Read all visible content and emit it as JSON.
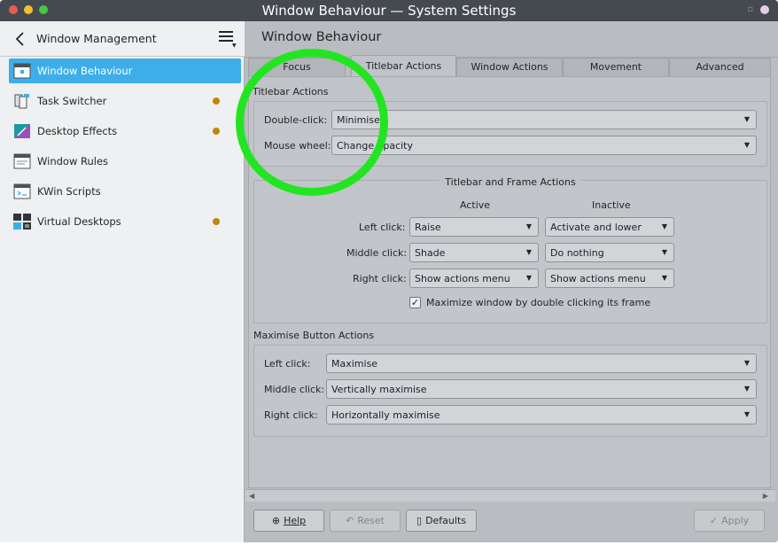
{
  "window": {
    "title": "Window Behaviour — System Settings"
  },
  "sidebar": {
    "title": "Window Management",
    "items": [
      {
        "label": "Window Behaviour",
        "selected": true,
        "dot": false
      },
      {
        "label": "Task Switcher",
        "selected": false,
        "dot": true
      },
      {
        "label": "Desktop Effects",
        "selected": false,
        "dot": true
      },
      {
        "label": "Window Rules",
        "selected": false,
        "dot": false
      },
      {
        "label": "KWin Scripts",
        "selected": false,
        "dot": false
      },
      {
        "label": "Virtual Desktops",
        "selected": false,
        "dot": true
      }
    ],
    "dot_color": "#c0860f",
    "selected_color": "#3daee9"
  },
  "main": {
    "title": "Window Behaviour",
    "tabs": [
      {
        "label": "Focus",
        "active": false
      },
      {
        "label": "Titlebar Actions",
        "active": true
      },
      {
        "label": "Window Actions",
        "active": false
      },
      {
        "label": "Movement",
        "active": false
      },
      {
        "label": "Advanced",
        "active": false
      }
    ]
  },
  "titlebar_actions": {
    "group_title": "Titlebar Actions",
    "double_click": {
      "label": "Double-click:",
      "value": "Minimise"
    },
    "mouse_wheel": {
      "label": "Mouse wheel:",
      "value": "Change opacity"
    }
  },
  "frame_actions": {
    "group_title": "Titlebar and Frame Actions",
    "col_active": "Active",
    "col_inactive": "Inactive",
    "rows": [
      {
        "label": "Left click:",
        "active": "Raise",
        "inactive": "Activate and lower"
      },
      {
        "label": "Middle click:",
        "active": "Shade",
        "inactive": "Do nothing"
      },
      {
        "label": "Right click:",
        "active": "Show actions menu",
        "inactive": "Show actions menu"
      }
    ],
    "checkbox": {
      "label": "Maximize window by double clicking its frame",
      "checked": true
    }
  },
  "maximise_actions": {
    "group_title": "Maximise Button Actions",
    "rows": [
      {
        "label": "Left click:",
        "value": "Maximise"
      },
      {
        "label": "Middle click:",
        "value": "Vertically maximise"
      },
      {
        "label": "Right click:",
        "value": "Horizontally maximise"
      }
    ]
  },
  "footer": {
    "help": "Help",
    "reset": "Reset",
    "defaults": "Defaults",
    "apply": "Apply"
  },
  "annotation": {
    "color": "#22e522"
  }
}
